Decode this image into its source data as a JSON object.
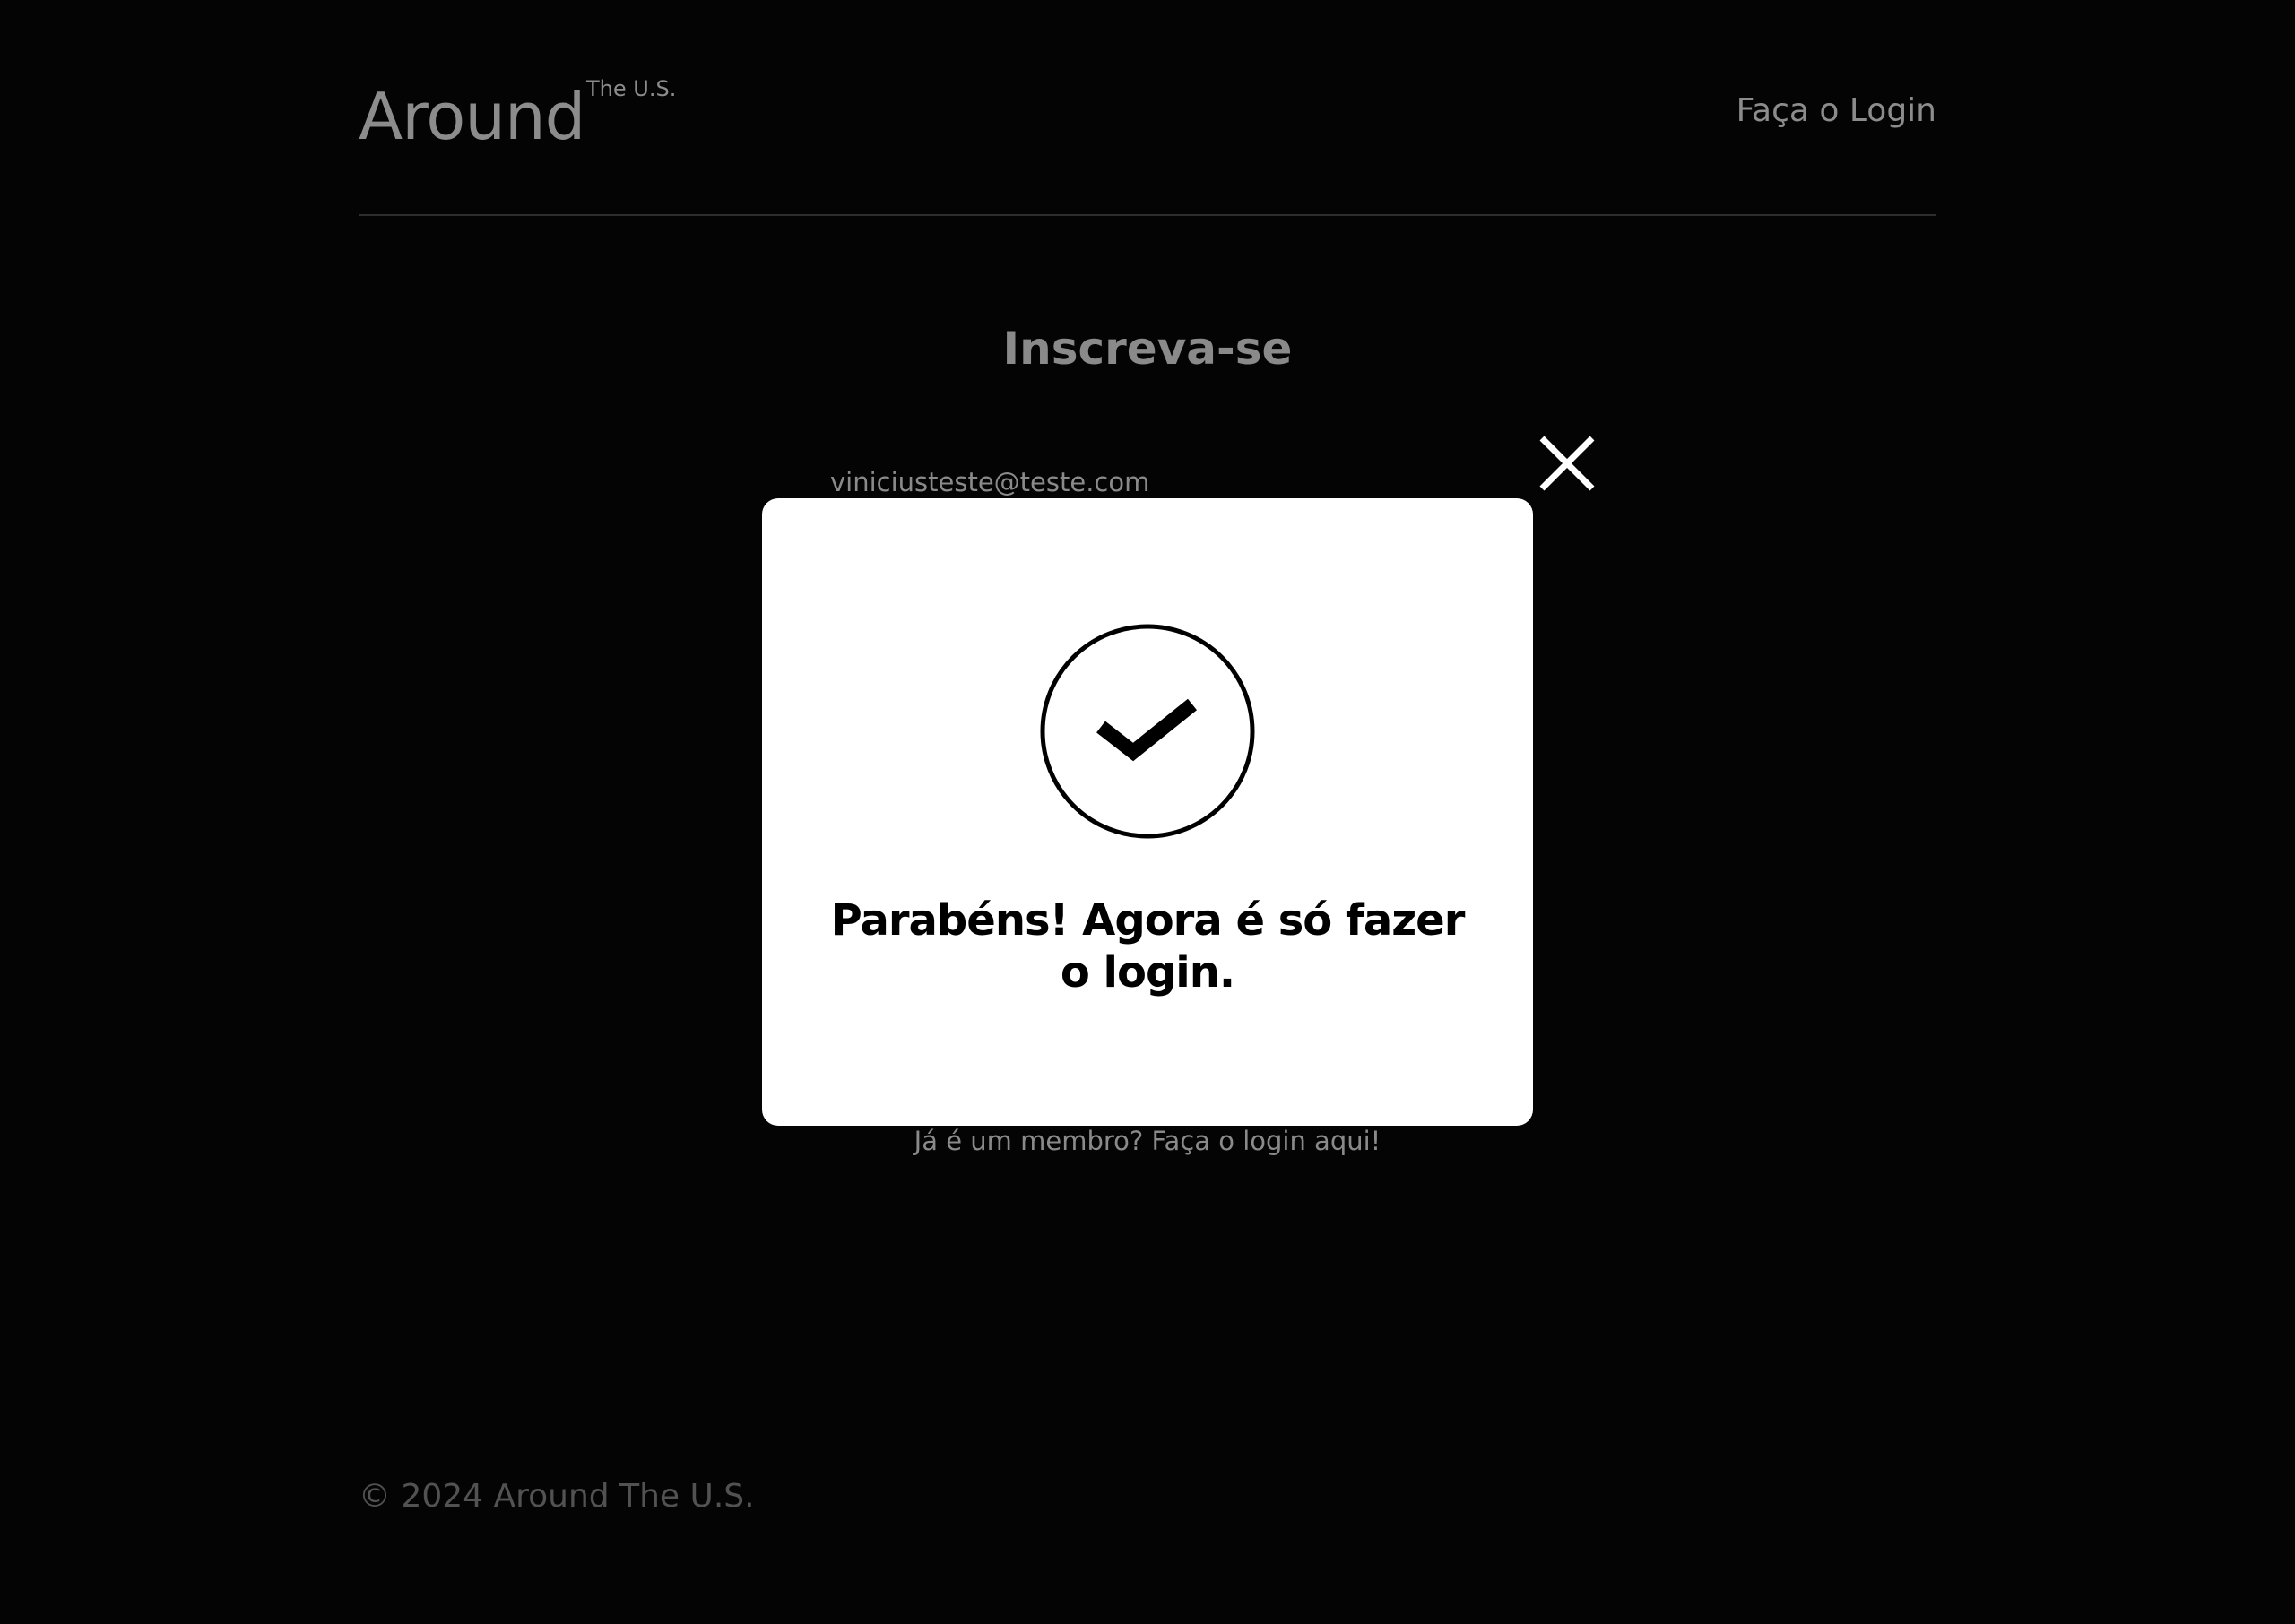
{
  "header": {
    "logo_main": "Around",
    "logo_sup": "The U.S.",
    "login_link": "Faça o Login"
  },
  "form": {
    "title": "Inscreva-se",
    "email_value": "viniciusteste@teste.com",
    "member_link": "Já é um membro? Faça o login aqui!"
  },
  "modal": {
    "icon": "check-circle-icon",
    "message": "Parabéns! Agora é só fazer o login.",
    "close_icon": "close-icon"
  },
  "footer": {
    "text": "© 2024 Around The U.S."
  },
  "colors": {
    "background": "#040404",
    "muted_text": "#8c8c8c",
    "footer_text": "#525252",
    "modal_background": "#ffffff"
  }
}
